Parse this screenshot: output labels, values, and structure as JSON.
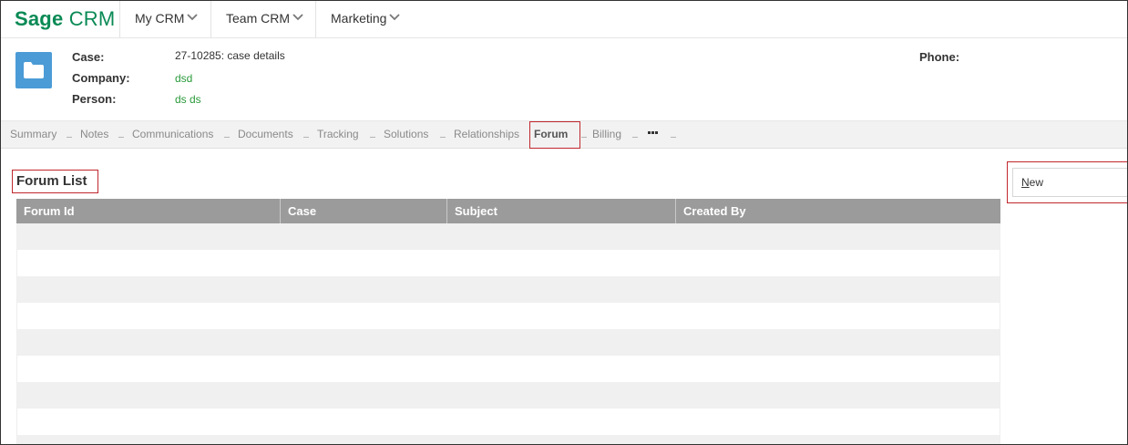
{
  "brand": {
    "sage": "Sage",
    "crm": "CRM"
  },
  "topnav": {
    "items": [
      {
        "label": "My CRM",
        "icon": "chevron-down-icon"
      },
      {
        "label": "Team CRM",
        "icon": "chevron-down-icon"
      },
      {
        "label": "Marketing",
        "icon": "chevron-down-icon"
      }
    ]
  },
  "entity": {
    "icon": "folder-icon",
    "icon_color": "#4b9bd6",
    "case_label": "Case:",
    "case_value": "27-10285: case details",
    "company_label": "Company:",
    "company_value": "dsd",
    "person_label": "Person:",
    "person_value": "ds ds",
    "phone_label": "Phone:"
  },
  "tabs": [
    {
      "label": "Summary"
    },
    {
      "label": "Notes"
    },
    {
      "label": "Communications"
    },
    {
      "label": "Documents"
    },
    {
      "label": "Tracking"
    },
    {
      "label": "Solutions"
    },
    {
      "label": "Relationships"
    },
    {
      "label": "Forum",
      "active": true
    },
    {
      "label": "Billing"
    }
  ],
  "more_icon": "ellipsis-icon",
  "forum_list": {
    "title": "Forum List",
    "columns": [
      "Forum Id",
      "Case",
      "Subject",
      "Created By"
    ],
    "rows": []
  },
  "actions": {
    "new_label": "New",
    "new_accesskey": "N"
  },
  "colors": {
    "brand": "#0a8a55",
    "link": "#2a9a3a",
    "grid_header": "#9b9b9b",
    "highlight": "#c0272d"
  }
}
